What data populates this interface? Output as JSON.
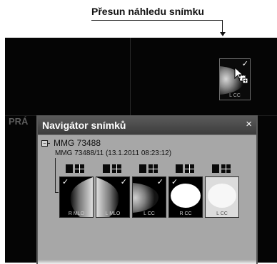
{
  "annotation": {
    "text": "Přesun náhledu snímku"
  },
  "viewer": {
    "ghost_label": "PRÁ",
    "dragged_thumbnail": {
      "label": "L CC",
      "checked": true
    }
  },
  "dialog": {
    "title": "Navigátor snímků",
    "close_glyph": "×",
    "tree": {
      "toggle_glyph": "−",
      "patient": "MMG 73488",
      "study": "MMG 73488/11 (13.1.2011 08:23:12)"
    },
    "thumbnails": [
      {
        "label": "R MLO",
        "checked": true,
        "check_side": "left"
      },
      {
        "label": "L MLO",
        "checked": true,
        "check_side": "right"
      },
      {
        "label": "L CC",
        "checked": true,
        "check_side": "right"
      },
      {
        "label": "R CC",
        "checked": true,
        "check_side": "left"
      },
      {
        "label": "L CC",
        "checked": false,
        "check_side": "left"
      }
    ]
  },
  "colors": {
    "viewer_background": "#050505",
    "dialog_background": "#a7a7a7",
    "titlebar": "#4a4a4a"
  },
  "icons": [
    "check-icon",
    "close-icon",
    "cursor-arrow-icon",
    "tree-collapse-icon",
    "layout-single-icon",
    "layout-quad-icon"
  ]
}
